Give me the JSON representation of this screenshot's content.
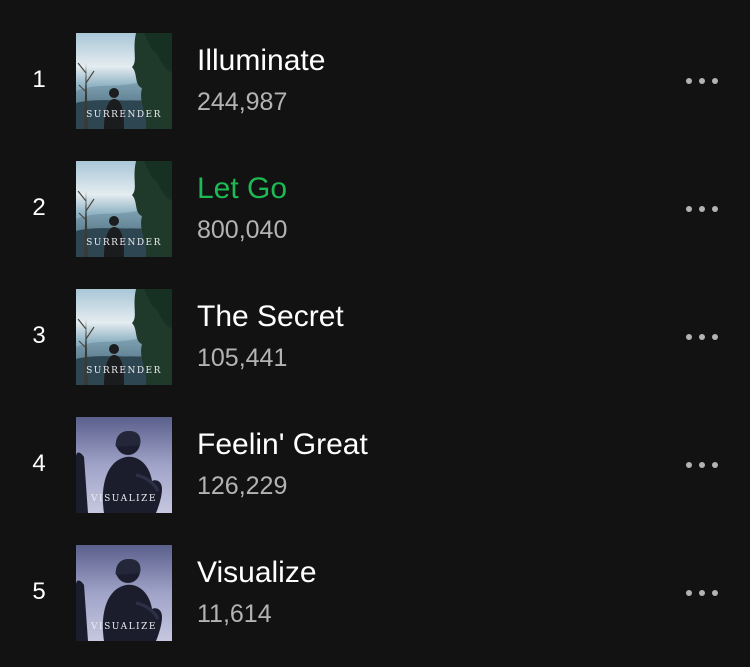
{
  "accent_color": "#1db954",
  "background_color": "#121212",
  "tracks": [
    {
      "index": "1",
      "title": "Illuminate",
      "plays": "244,987",
      "album": "SURRENDER",
      "active": false,
      "more_icon": "more-horizontal-icon"
    },
    {
      "index": "2",
      "title": "Let Go",
      "plays": "800,040",
      "album": "SURRENDER",
      "active": true,
      "more_icon": "more-horizontal-icon"
    },
    {
      "index": "3",
      "title": "The Secret",
      "plays": "105,441",
      "album": "SURRENDER",
      "active": false,
      "more_icon": "more-horizontal-icon"
    },
    {
      "index": "4",
      "title": "Feelin' Great",
      "plays": "126,229",
      "album": "VISUALIZE",
      "active": false,
      "more_icon": "more-horizontal-icon"
    },
    {
      "index": "5",
      "title": "Visualize",
      "plays": "11,614",
      "album": "VISUALIZE",
      "active": false,
      "more_icon": "more-horizontal-icon"
    }
  ]
}
